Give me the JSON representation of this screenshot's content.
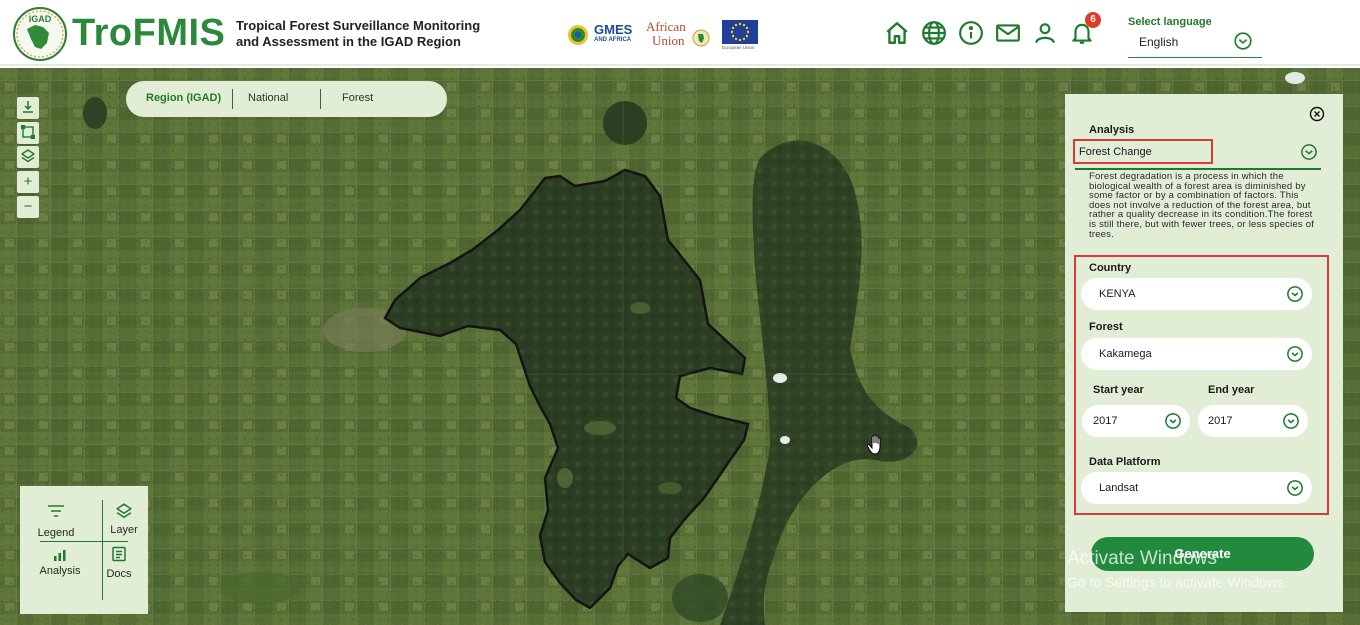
{
  "header": {
    "logo_seal_text": "IGAD",
    "brand": "TroFMIS",
    "tagline": "Tropical Forest Surveillance Monitoring and Assessment in the IGAD Region",
    "partners": {
      "gmes_text": "GMES",
      "gmes_sub": "AND AFRICA",
      "au_line1": "African",
      "au_line2": "Union",
      "eu_caption": "European Union"
    },
    "icons": [
      "home-icon",
      "globe-icon",
      "info-icon",
      "mail-icon",
      "user-icon",
      "bell-icon"
    ],
    "notification_count": "6",
    "language_label": "Select language",
    "language_value": "English"
  },
  "region_tabs": [
    {
      "label": "Region (IGAD)",
      "active": true
    },
    {
      "label": "National",
      "active": false
    },
    {
      "label": "Forest",
      "active": false
    }
  ],
  "map_tools": [
    "download-icon",
    "draw-rectangle-icon",
    "layers-icon",
    "zoom-in-icon",
    "zoom-out-icon"
  ],
  "map_tool_glyphs": {
    "zoom_in": "+",
    "zoom_out": "−"
  },
  "toolbox": {
    "legend": "Legend",
    "layer": "Layer",
    "analysis": "Analysis",
    "docs": "Docs"
  },
  "panel": {
    "analysis_label": "Analysis",
    "analysis_value": "Forest Change",
    "description": "Forest degradation is a process in which the biological wealth of a forest area is diminished by some factor or by a combination of factors. This does not involve a reduction of the forest area, but rather a quality decrease in its condition.The forest is still there, but with fewer trees, or less species of trees.",
    "country_label": "Country",
    "country_value": "KENYA",
    "forest_label": "Forest",
    "forest_value": "Kakamega",
    "start_year_label": "Start year",
    "start_year_value": "2017",
    "end_year_label": "End year",
    "end_year_value": "2017",
    "platform_label": "Data Platform",
    "platform_value": "Landsat",
    "generate_label": "Generate"
  },
  "watermark": {
    "title": "Activate Windows",
    "subtitle": "Go to Settings to activate Windows."
  },
  "colors": {
    "brand_green": "#2a8a3a",
    "panel_bg": "#e2edd6",
    "highlight_red": "#d83a3a",
    "badge_red": "#e23a2a"
  }
}
